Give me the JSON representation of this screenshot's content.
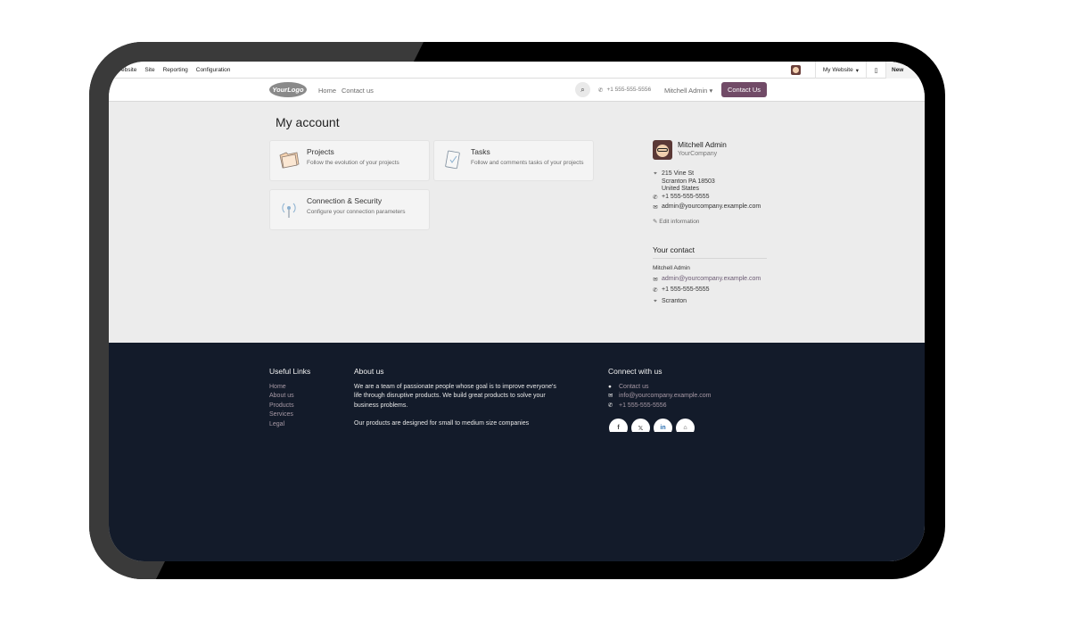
{
  "adminbar": {
    "menu": [
      "ebsite",
      "Site",
      "Reporting",
      "Configuration"
    ],
    "website_switch": "My Website",
    "mobile_icon": "mobile-icon",
    "new_label": "New"
  },
  "header": {
    "logo_text": "YourLogo",
    "nav": [
      "Home",
      "Contact us"
    ],
    "phone": "+1 555-555-5556",
    "user_name": "Mitchell Admin",
    "contact_button": "Contact Us"
  },
  "main": {
    "title": "My account",
    "cards": [
      {
        "title": "Projects",
        "description": "Follow the evolution of your projects",
        "icon": "folder-icon"
      },
      {
        "title": "Tasks",
        "description": "Follow and comments tasks of your projects",
        "icon": "task-icon"
      },
      {
        "title": "Connection & Security",
        "description": "Configure your connection parameters",
        "icon": "antenna-icon"
      }
    ]
  },
  "profile": {
    "name": "Mitchell Admin",
    "company": "YourCompany",
    "address_line1": "215 Vine St",
    "address_line2": "Scranton PA 18503",
    "address_line3": "United States",
    "phone": "+1 555-555-5555",
    "email": "admin@yourcompany.example.com",
    "edit_label": "Edit information"
  },
  "your_contact": {
    "title": "Your contact",
    "name": "Mitchell Admin",
    "email": "admin@yourcompany.example.com",
    "phone": "+1 555-555-5555",
    "city": "Scranton"
  },
  "footer": {
    "useful_links_title": "Useful Links",
    "useful_links": [
      "Home",
      "About us",
      "Products",
      "Services",
      "Legal"
    ],
    "about_title": "About us",
    "about_p1": "We are a team of passionate people whose goal is to improve everyone's life through disruptive products. We build great products to solve your business problems.",
    "about_p2": "Our products are designed for small to medium size companies",
    "connect_title": "Connect with us",
    "contact_link": "Contact us",
    "email": "info@yourcompany.example.com",
    "phone": "+1 555-555-5556",
    "socials": [
      {
        "icon": "facebook-icon",
        "glyph": "f"
      },
      {
        "icon": "x-twitter-icon",
        "glyph": "𝕏"
      },
      {
        "icon": "linkedin-icon",
        "glyph": "in"
      },
      {
        "icon": "home-icon",
        "glyph": "⌂"
      }
    ]
  },
  "colors": {
    "brand": "#714b67",
    "footer_bg": "#131b2a",
    "page_bg": "#ececec"
  }
}
